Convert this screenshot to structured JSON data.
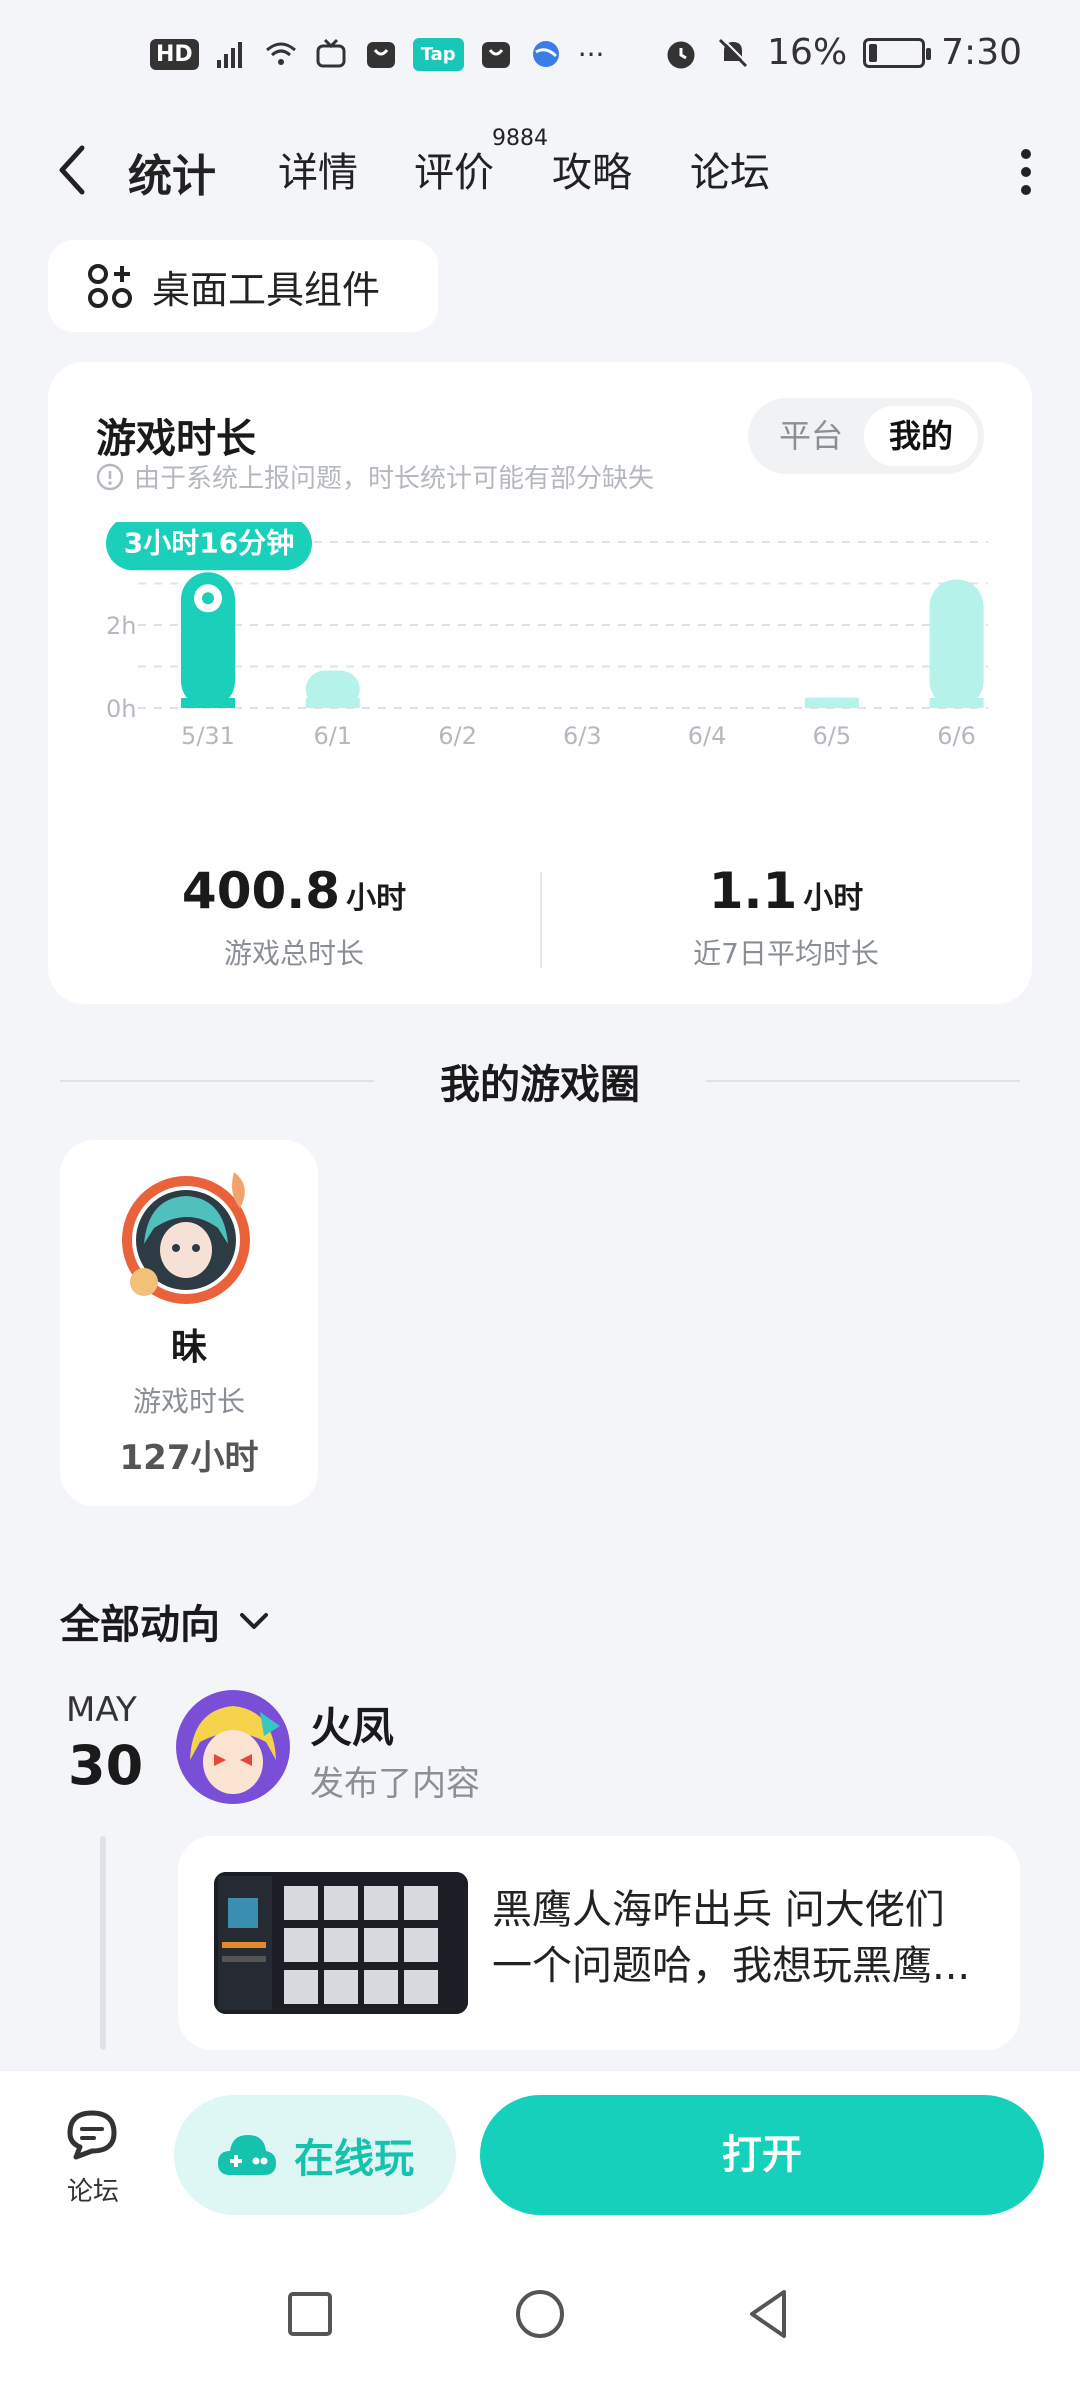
{
  "status_bar": {
    "hd": "HD",
    "tap_label": "Tap",
    "more": "···",
    "battery": "16%",
    "battery_level": 0.16,
    "time": "7:30"
  },
  "nav": {
    "tabs": [
      {
        "label": "统计",
        "active": true
      },
      {
        "label": "详情",
        "active": false
      },
      {
        "label": "评价",
        "active": false,
        "badge": "9884"
      },
      {
        "label": "攻略",
        "active": false
      },
      {
        "label": "论坛",
        "active": false
      }
    ]
  },
  "widget": {
    "label": "桌面工具组件"
  },
  "playtime": {
    "title": "游戏时长",
    "note": "由于系统上报问题，时长统计可能有部分缺失",
    "toggle": {
      "options": [
        "平台",
        "我的"
      ],
      "selected": "我的"
    },
    "total_value": "400.8",
    "total_unit": "小时",
    "total_label": "游戏总时长",
    "avg_value": "1.1",
    "avg_unit": "小时",
    "avg_label": "近7日平均时长"
  },
  "chart_data": {
    "type": "bar",
    "categories": [
      "5/31",
      "6/1",
      "6/2",
      "6/3",
      "6/4",
      "6/5",
      "6/6"
    ],
    "values": [
      3.27,
      0.9,
      0,
      0,
      0,
      0.25,
      3.1
    ],
    "unit": "h",
    "y_ticks": [
      "0h",
      "2h",
      "4"
    ],
    "ylim": [
      0,
      4
    ],
    "grid": true,
    "tooltip": {
      "category": "5/31",
      "label": "3小时16分钟"
    },
    "colors": {
      "highlight": "#1ad0bb",
      "normal": "#b4f2ea"
    }
  },
  "circle": {
    "title": "我的游戏圈",
    "member": {
      "name": "昧",
      "label": "游戏时长",
      "hours": "127小时"
    }
  },
  "feed": {
    "filter_label": "全部动向",
    "date_month": "MAY",
    "date_day": "30",
    "user": "火凤",
    "action": "发布了内容",
    "post_line1": "黑鹰人海咋出兵 问大佬们",
    "post_line2": "一个问题哈，我想玩黑鹰..."
  },
  "actions": {
    "forum_label": "论坛",
    "online_label": "在线玩",
    "open_label": "打开"
  },
  "colors": {
    "accent": "#15d1bb",
    "accent_light": "#b4f2ea"
  }
}
